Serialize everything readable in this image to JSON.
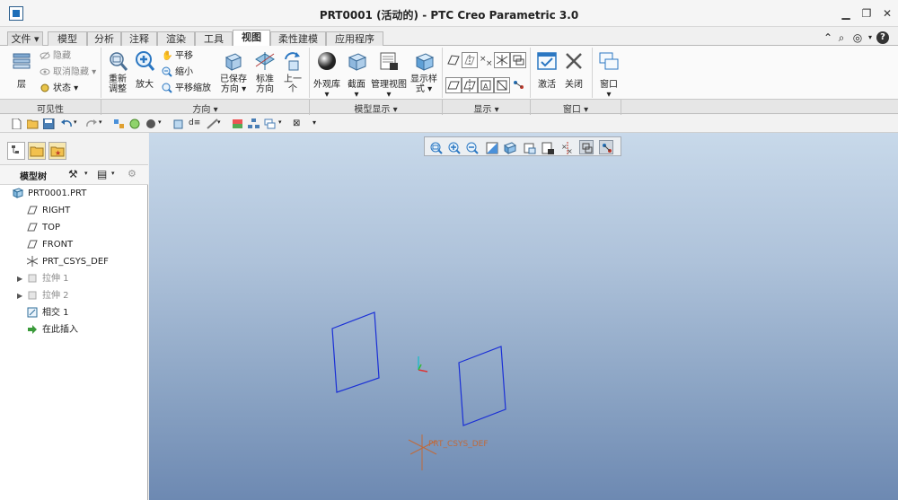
{
  "window": {
    "title": "PRT0001 (活动的) - PTC Creo Parametric 3.0"
  },
  "tabs": [
    {
      "label": "文件"
    },
    {
      "label": "模型"
    },
    {
      "label": "分析"
    },
    {
      "label": "注释"
    },
    {
      "label": "渲染"
    },
    {
      "label": "工具"
    },
    {
      "label": "视图"
    },
    {
      "label": "柔性建模"
    },
    {
      "label": "应用程序"
    }
  ],
  "active_tab": "视图",
  "ribbon": {
    "visibility": {
      "layer": "层",
      "hide": "隐藏",
      "unhide": "取消隐藏",
      "status": "状态"
    },
    "orientation": {
      "refit": "重新调整",
      "zoom_in": "放大",
      "pan": "平移",
      "zoom_out": "缩小",
      "pan_zoom": "平移缩放",
      "saved_views": "已保存方向",
      "standard_orient": "标准方向",
      "previous": "上一个"
    },
    "model_display": {
      "appearance": "外观库",
      "section": "截面",
      "manage_views": "管理视图",
      "display_style": "显示样式"
    },
    "window": {
      "activate": "激活",
      "close": "关闭",
      "windows": "窗口"
    },
    "groups": {
      "visibility": "可见性",
      "orientation": "方向",
      "model_display": "模型显示",
      "display": "显示",
      "window": "窗口"
    }
  },
  "model_tree": {
    "title": "模型树",
    "items": [
      {
        "label": "PRT0001.PRT",
        "icon": "part-icon"
      },
      {
        "label": "RIGHT",
        "icon": "datum-plane-icon"
      },
      {
        "label": "TOP",
        "icon": "datum-plane-icon"
      },
      {
        "label": "FRONT",
        "icon": "datum-plane-icon"
      },
      {
        "label": "PRT_CSYS_DEF",
        "icon": "csys-icon"
      },
      {
        "label": "拉伸 1",
        "icon": "extrude-icon"
      },
      {
        "label": "拉伸 2",
        "icon": "extrude-icon"
      },
      {
        "label": "相交 1",
        "icon": "intersect-icon"
      },
      {
        "label": "在此插入",
        "icon": "insert-here-icon"
      }
    ]
  },
  "viewport": {
    "csys_label": "PRT_CSYS_DEF"
  },
  "colors": {
    "accent_blue": "#1f6fb8",
    "sketch_curve": "#1a2fd6",
    "csys_orange": "#c06a3a"
  }
}
